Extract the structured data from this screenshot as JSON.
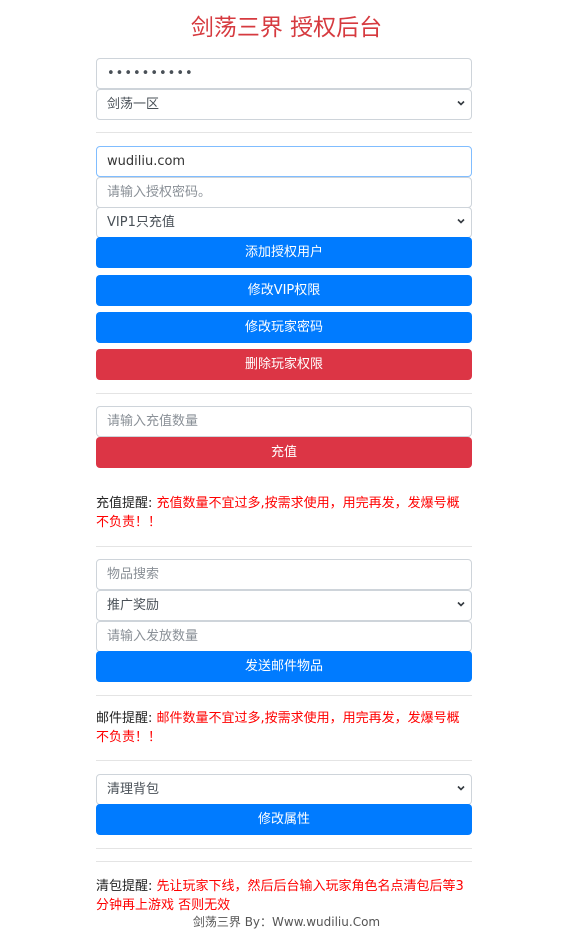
{
  "title": "剑荡三界 授权后台",
  "password_value": "••••••••••",
  "server_select": "剑荡一区",
  "account_value": "wudiliu.com",
  "auth_password_placeholder": "请输入授权密码。",
  "vip_select": "VIP1只充值",
  "buttons": {
    "add_user": "添加授权用户",
    "modify_vip": "修改VIP权限",
    "modify_password": "修改玩家密码",
    "delete_permission": "删除玩家权限",
    "recharge": "充值",
    "send_mail": "发送邮件物品",
    "modify_attr": "修改属性"
  },
  "recharge_placeholder": "请输入充值数量",
  "recharge_note": {
    "label": "充值提醒:",
    "text": " 充值数量不宜过多,按需求使用，用完再发，发爆号概不负责！！"
  },
  "item_search_placeholder": "物品搜索",
  "item_select": "推广奖励",
  "send_qty_placeholder": "请输入发放数量",
  "mail_note": {
    "label": "邮件提醒:",
    "text": " 邮件数量不宜过多,按需求使用，用完再发，发爆号概不负责！！"
  },
  "action_select": "清理背包",
  "clear_note": {
    "label": "清包提醒:",
    "text": " 先让玩家下线，然后后台输入玩家角色名点清包后等3分钟再上游戏 否则无效"
  },
  "footer": "剑荡三界 By：Www.wudiliu.Com",
  "colors": {
    "primary": "#007bff",
    "danger": "#dc3545",
    "title": "#d63a3f",
    "warning_text": "#ff0000"
  }
}
